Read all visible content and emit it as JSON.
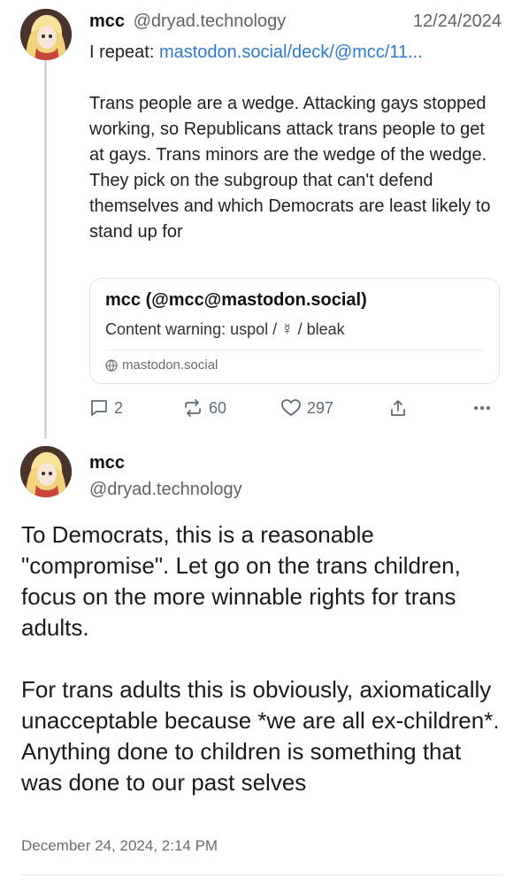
{
  "reply": {
    "author_name": "mcc",
    "author_handle": "@dryad.technology",
    "date": "12/24/2024",
    "line1_prefix": "I repeat: ",
    "line1_link": "mastodon.social/deck/@mcc/11...",
    "body": "Trans people are a wedge. Attacking gays stopped working, so Republicans attack trans people to get at gays. Trans minors are the wedge of the wedge. They pick on the subgroup that can't defend themselves and which Democrats are least likely to stand up for",
    "quote": {
      "author": "mcc (@mcc@mastodon.social)",
      "content_warning": "Content warning: uspol / ☿ / bleak",
      "domain": "mastodon.social"
    },
    "actions": {
      "replies": "2",
      "reposts": "60",
      "likes": "297"
    }
  },
  "post": {
    "author_name": "mcc",
    "author_handle": "@dryad.technology",
    "paragraph1": "To Democrats, this is a reasonable \"compromise\". Let go on the trans children, focus on the more winnable rights for trans adults.",
    "paragraph2": "For trans adults this is obviously, axiomatically unacceptable because *we are all ex-children*. Anything done to children is something that was done to our past selves",
    "timestamp": "December 24, 2024, 2:14 PM"
  },
  "icons": {
    "reply": "speech-bubble-icon",
    "repost": "repost-arrows-icon",
    "like": "heart-icon",
    "share": "share-upload-icon",
    "more": "more-dots-icon",
    "globe": "globe-icon"
  },
  "colors": {
    "link": "#2b7bd1",
    "muted": "#5f6368",
    "thread_line": "#d9d9dd"
  }
}
